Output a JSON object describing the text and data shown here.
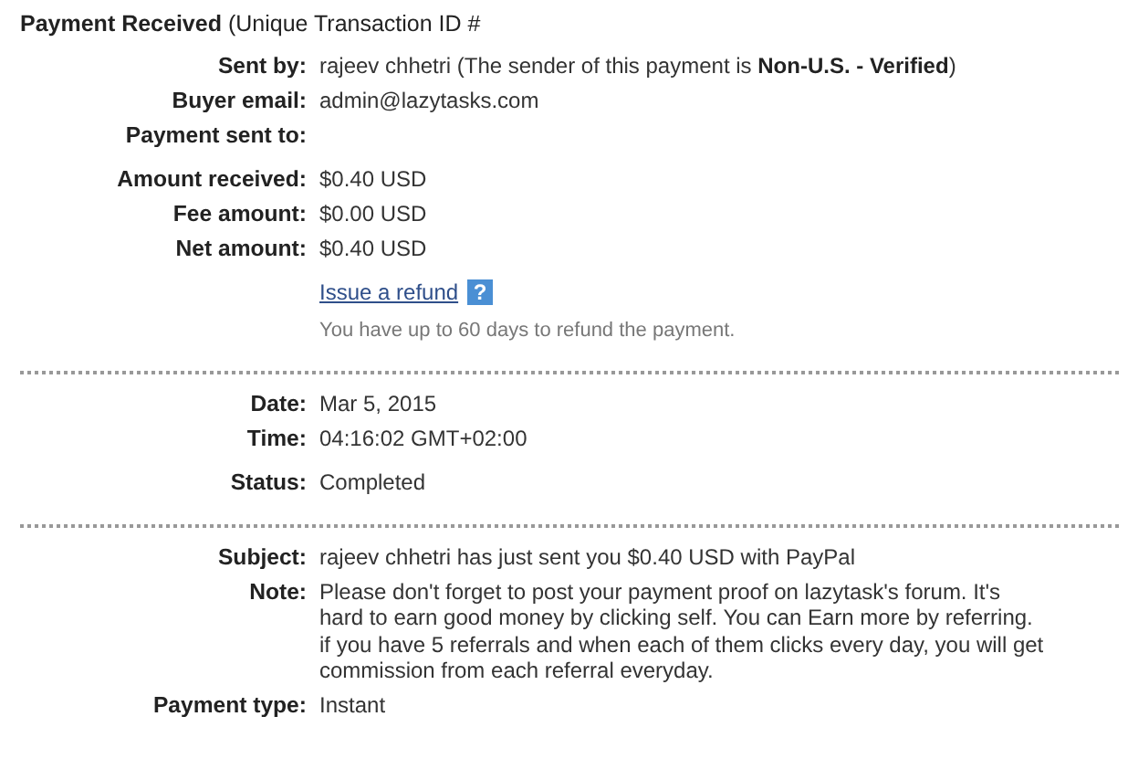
{
  "title": "**Payment Received** (Unique Transaction ID #",
  "sections": [
    {
      "groups": [
        {
          "rows": [
            {
              "label": "Sent by:",
              "value": "rajeev chhetri (The sender of this payment is **Non-U.S. - Verified**)"
            },
            {
              "label": "Buyer email:",
              "value": "admin@lazytasks.com"
            },
            {
              "label": "Payment sent to:"
            }
          ]
        },
        {
          "rows": [
            {
              "label": "Amount received:",
              "value": "$0.40 USD"
            },
            {
              "label": "Fee amount:",
              "value": "$0.00 USD"
            },
            {
              "label": "Net amount:",
              "value": "$0.40 USD"
            }
          ]
        }
      ],
      "refund": {
        "link": "Issue a refund",
        "help": "?",
        "hint": "You have up to 60 days to refund the payment."
      }
    },
    {
      "groups": [
        {
          "rows": [
            {
              "label": "Date:",
              "value": "Mar 5, 2015"
            },
            {
              "label": "Time:",
              "value": "04:16:02 GMT+02:00"
            }
          ]
        },
        {
          "rows": [
            {
              "label": "Status:",
              "value": "Completed"
            }
          ]
        }
      ]
    },
    {
      "groups": [
        {
          "rows": [
            {
              "label": "Subject:",
              "value": "rajeev chhetri has just sent you $0.40 USD with PayPal"
            },
            {
              "label": "Note:",
              "value": "Please don't forget to post your payment proof on lazytask's forum. It's hard to earn good money by clicking self. You can Earn more by referring. if you have 5 referrals and when each of them clicks every day, you will get commission from each referral everyday."
            },
            {
              "label": "Payment type:",
              "value": "Instant"
            }
          ]
        }
      ]
    }
  ]
}
